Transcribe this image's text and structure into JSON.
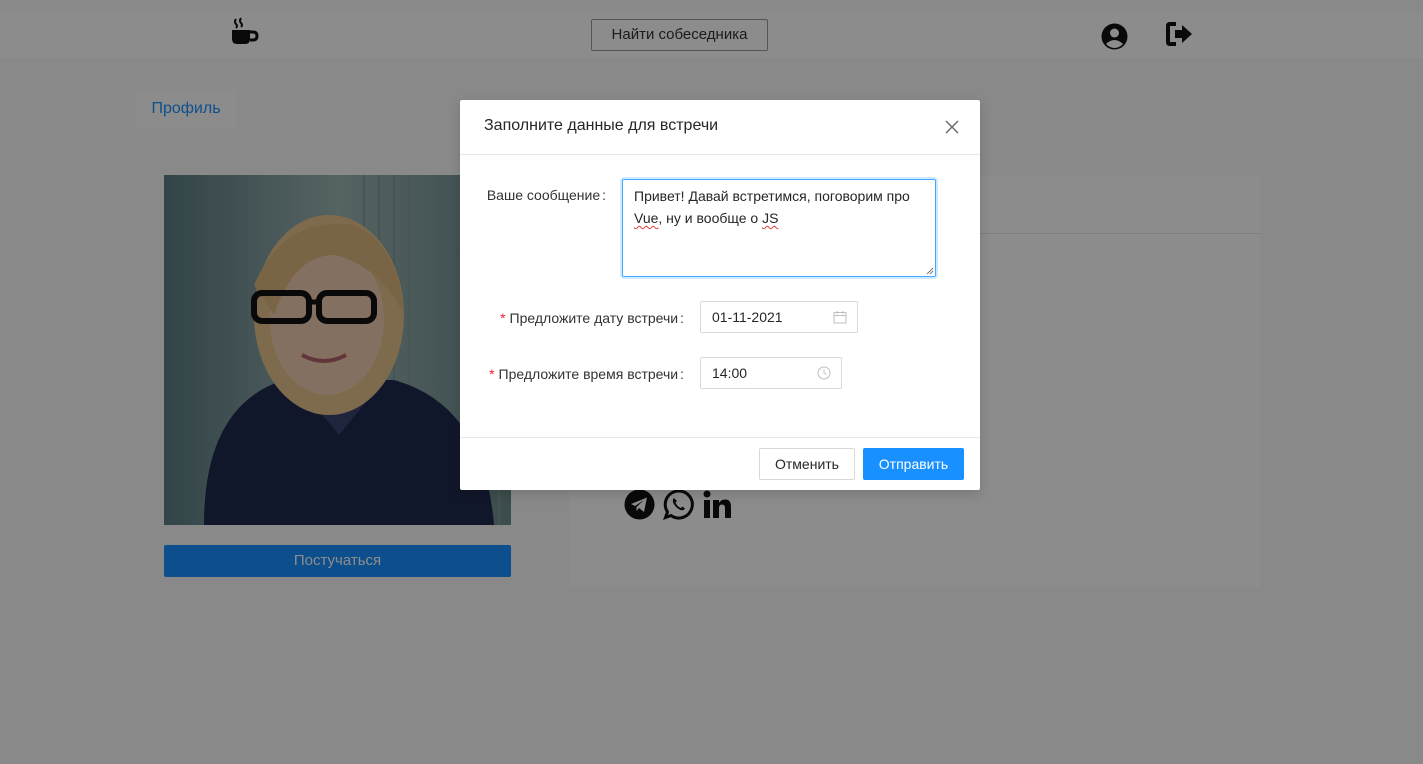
{
  "header": {
    "logo_icon": "coffee-cup-icon",
    "find_button_label": "Найти собеседника",
    "profile_icon": "user-circle-icon",
    "logout_icon": "sign-out-icon"
  },
  "page": {
    "profile_tab_label": "Профиль",
    "knock_button_label": "Постучаться",
    "social_icons": [
      "telegram-icon",
      "whatsapp-icon",
      "linkedin-icon"
    ]
  },
  "modal": {
    "title": "Заполните данные для встречи",
    "message_label": "Ваше сообщение",
    "message_value_part1": "Привет! Давай встретимся, поговорим про ",
    "message_word1": "Vue",
    "message_value_part2": ", ну и вообще о ",
    "message_word2": "JS",
    "date_label": "Предложите дату встречи",
    "date_value": "01-11-2021",
    "time_label": "Предложите время встречи",
    "time_value": "14:00",
    "required_mark": "*",
    "colon": ":",
    "cancel_label": "Отменить",
    "submit_label": "Отправить"
  },
  "colors": {
    "accent": "#1890ff",
    "required": "#f5222d",
    "overlay": "rgba(0,0,0,0.45)"
  }
}
